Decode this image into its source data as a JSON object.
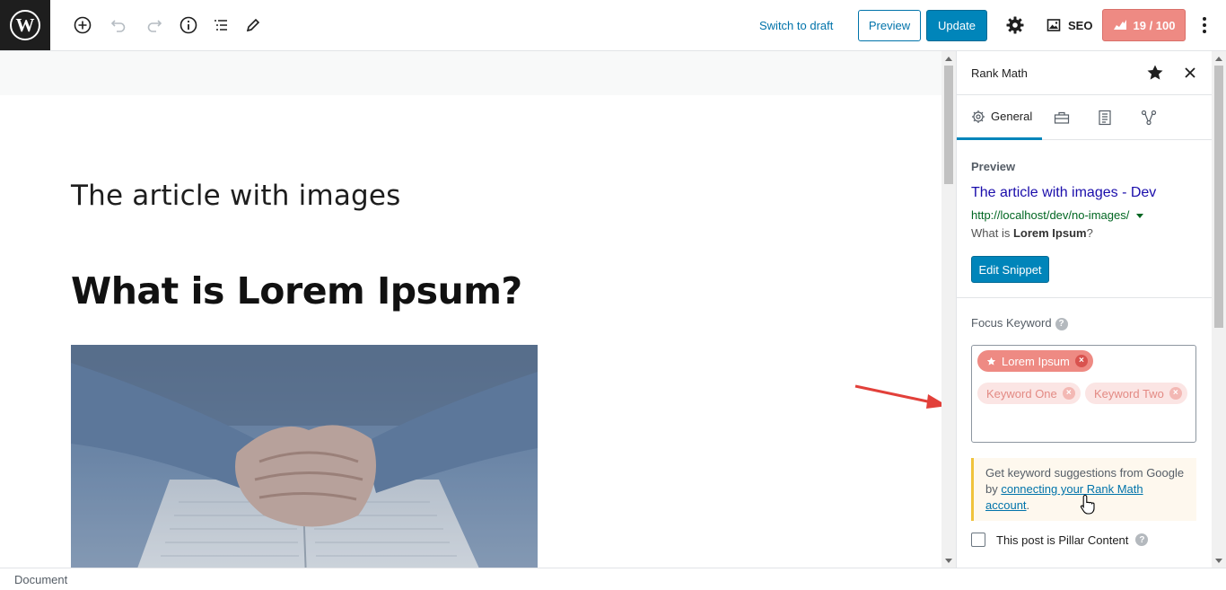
{
  "toolbar": {
    "switch_to_draft": "Switch to draft",
    "preview_label": "Preview",
    "update_label": "Update",
    "seo_label": "SEO",
    "score_label": "19 / 100",
    "score_color": "#ee8a83",
    "icons": [
      "wordpress-logo",
      "add-block-icon",
      "undo-icon",
      "redo-icon",
      "info-icon",
      "outline-icon",
      "edit-icon",
      "gear-icon",
      "seo-image-icon",
      "more-vertical-icon"
    ]
  },
  "editor": {
    "post_title": "The article with images",
    "heading": "What is Lorem Ipsum?"
  },
  "sidebar": {
    "title": "Rank Math",
    "tabs": [
      {
        "label": "General",
        "icon": "gear-icon",
        "active": true
      },
      {
        "label": "",
        "icon": "toolbox-icon"
      },
      {
        "label": "",
        "icon": "document-icon"
      },
      {
        "label": "",
        "icon": "schema-icon"
      }
    ],
    "preview": {
      "label": "Preview",
      "title": "The article with images - Dev",
      "url": "http://localhost/dev/no-images/",
      "desc_prefix": "What is ",
      "desc_bold": "Lorem Ipsum",
      "desc_suffix": "?",
      "edit_snippet": "Edit Snippet"
    },
    "focus_keyword": {
      "label": "Focus Keyword",
      "help": "?",
      "primary": "Lorem Ipsum",
      "secondary": [
        "Keyword One",
        "Keyword Two"
      ]
    },
    "notice": {
      "text": "Get keyword suggestions from Google by ",
      "link": "connecting your Rank Math account",
      "end": "."
    },
    "pillar_label": "This post is Pillar Content",
    "pillar_checked": false
  },
  "footer": {
    "breadcrumb": "Document"
  },
  "colors": {
    "accent": "#0085ba",
    "link": "#0073aa",
    "keyword_primary": "#ee8a83",
    "notice_border": "#f0c33c",
    "arrow": "#e2403a"
  }
}
